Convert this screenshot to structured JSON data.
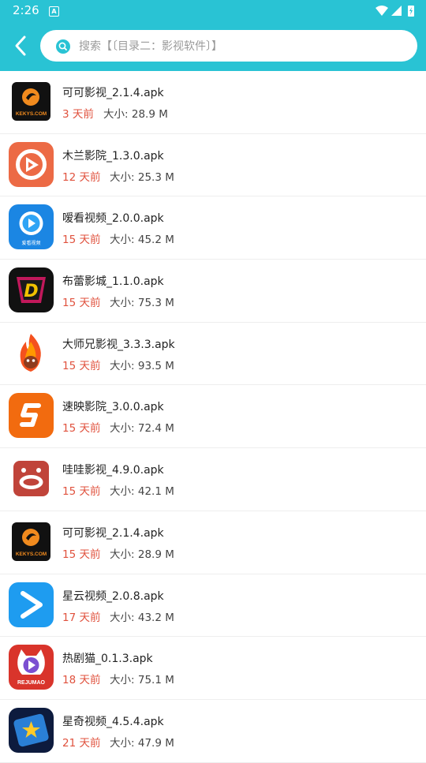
{
  "status_bar": {
    "time": "2:26",
    "badge": "A"
  },
  "search": {
    "placeholder": "搜索【〔目录二：影视软件〕】"
  },
  "size_label": "大小:",
  "items": [
    {
      "name": "可可影视_2.1.4.apk",
      "age": "3 天前",
      "size": "28.9 M",
      "icon": "kekys-icon"
    },
    {
      "name": "木兰影院_1.3.0.apk",
      "age": "12 天前",
      "size": "25.3 M",
      "icon": "mulan-icon"
    },
    {
      "name": "嗳看视频_2.0.0.apk",
      "age": "15 天前",
      "size": "45.2 M",
      "icon": "aikan-icon"
    },
    {
      "name": "布蕾影城_1.1.0.apk",
      "age": "15 天前",
      "size": "75.3 M",
      "icon": "bulei-icon"
    },
    {
      "name": "大师兄影视_3.3.3.apk",
      "age": "15 天前",
      "size": "93.5 M",
      "icon": "dashixiong-icon"
    },
    {
      "name": "速映影院_3.0.0.apk",
      "age": "15 天前",
      "size": "72.4 M",
      "icon": "suying-icon"
    },
    {
      "name": "哇哇影视_4.9.0.apk",
      "age": "15 天前",
      "size": "42.1 M",
      "icon": "wawa-icon"
    },
    {
      "name": "可可影视_2.1.4.apk",
      "age": "15 天前",
      "size": "28.9 M",
      "icon": "kekys-icon"
    },
    {
      "name": "星云视频_2.0.8.apk",
      "age": "17 天前",
      "size": "43.2 M",
      "icon": "xingyun-icon"
    },
    {
      "name": "热剧猫_0.1.3.apk",
      "age": "18 天前",
      "size": "75.1 M",
      "icon": "rejumao-icon"
    },
    {
      "name": "星奇视频_4.5.4.apk",
      "age": "21 天前",
      "size": "47.9 M",
      "icon": "xingqi-icon"
    }
  ],
  "icon_text": {
    "kekys": "KEKYS.COM",
    "aikan": "爱看视频",
    "rejumao": "REJUMAO",
    "bulei": "D"
  },
  "colors": {
    "header": "#29c3d4",
    "age": "#e0523e"
  }
}
